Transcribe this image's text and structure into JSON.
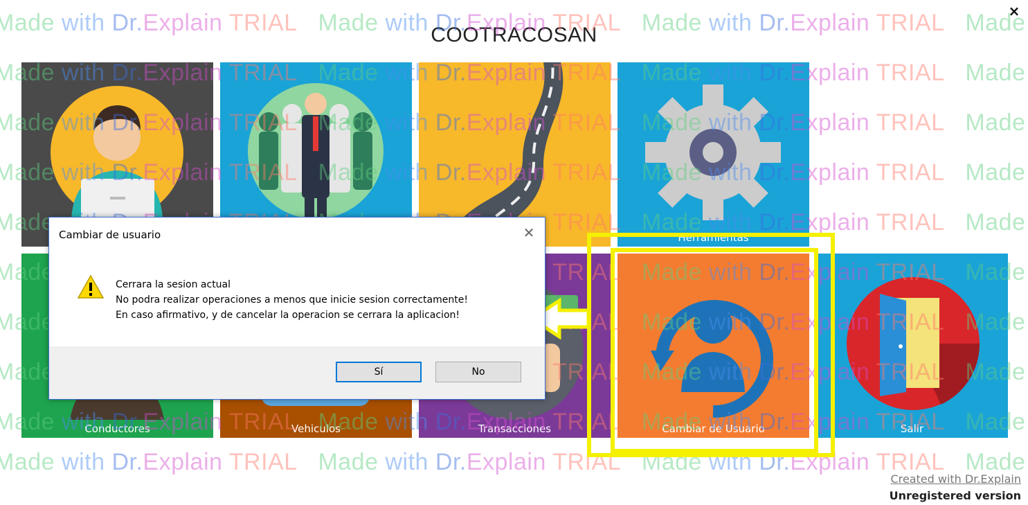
{
  "app": {
    "title": "COOTRACOSAN",
    "close_glyph": "×"
  },
  "tiles": {
    "usuario": {
      "label": "",
      "color": "#4a4a4a",
      "icon": "user-laptop-icon"
    },
    "empresa": {
      "label": "",
      "color": "#1aa3d7",
      "icon": "people-group-icon"
    },
    "rutas": {
      "label": "",
      "color": "#f7b82a",
      "icon": "road-icon"
    },
    "herramientas": {
      "label": "Herramientas",
      "color": "#1aa3d7",
      "icon": "gear-icon"
    },
    "conductores": {
      "label": "Conductores",
      "color": "#1ea34f",
      "icon": "driver-icon"
    },
    "vehiculos": {
      "label": "Vehiculos",
      "color": "#a84f00",
      "icon": "vehicle-icon"
    },
    "transacciones": {
      "label": "Transacciones",
      "color": "#7b3a98",
      "icon": "money-icon"
    },
    "cambiar": {
      "label": "Cambiar de Usuario",
      "color": "#f47c30",
      "icon": "change-user-icon"
    },
    "salir": {
      "label": "Salir",
      "color": "#1aa3d7",
      "icon": "exit-door-icon"
    }
  },
  "dialog": {
    "title": "Cambiar de usuario",
    "close_glyph": "✕",
    "icon": "warning-icon",
    "lines": [
      "Cerrara la sesion actual",
      "No podra realizar operaciones a menos que inicie sesion correctamente!",
      "En caso afirmativo, y de cancelar la operacion se cerrara la aplicacion!"
    ],
    "buttons": {
      "yes": "Sí",
      "no": "No"
    }
  },
  "annotation": {
    "highlight_color": "#f5f000",
    "arrow": "left-arrow"
  },
  "watermark": {
    "made": "Made",
    "with": "with",
    "dr": "Dr.",
    "explain": "Explain",
    "trial": "TRIAL"
  },
  "footer": {
    "created": "Created with Dr.Explain",
    "unregistered": "Unregistered version"
  }
}
